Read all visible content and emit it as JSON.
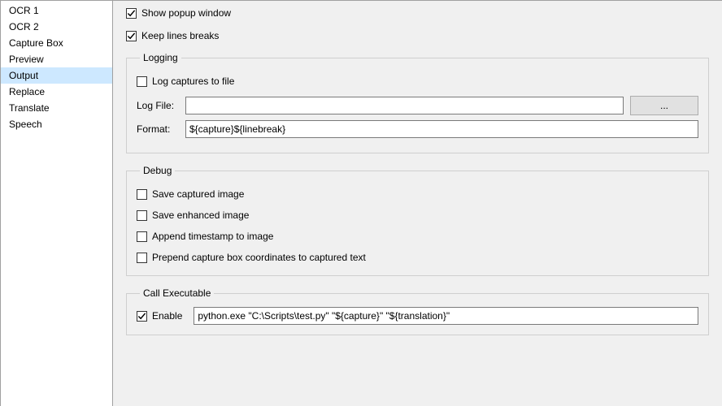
{
  "sidebar": {
    "items": [
      {
        "label": "OCR 1"
      },
      {
        "label": "OCR 2"
      },
      {
        "label": "Capture Box"
      },
      {
        "label": "Preview"
      },
      {
        "label": "Output"
      },
      {
        "label": "Replace"
      },
      {
        "label": "Translate"
      },
      {
        "label": "Speech"
      }
    ],
    "selected_index": 4
  },
  "top": {
    "show_popup_label": "Show popup window",
    "show_popup_checked": true,
    "keep_lines_label": "Keep lines breaks",
    "keep_lines_checked": true
  },
  "logging": {
    "legend": "Logging",
    "log_captures_label": "Log captures to file",
    "log_captures_checked": false,
    "log_file_label": "Log File:",
    "log_file_value": "",
    "browse_label": "...",
    "format_label": "Format:",
    "format_value": "${capture}${linebreak}"
  },
  "debug": {
    "legend": "Debug",
    "save_captured_label": "Save captured image",
    "save_captured_checked": false,
    "save_enhanced_label": "Save enhanced image",
    "save_enhanced_checked": false,
    "append_ts_label": "Append timestamp to image",
    "append_ts_checked": false,
    "prepend_coords_label": "Prepend capture box coordinates to captured text",
    "prepend_coords_checked": false
  },
  "call_exec": {
    "legend": "Call Executable",
    "enable_label": "Enable",
    "enable_checked": true,
    "command_value": "python.exe \"C:\\Scripts\\test.py\" \"${capture}\" \"${translation}\""
  }
}
